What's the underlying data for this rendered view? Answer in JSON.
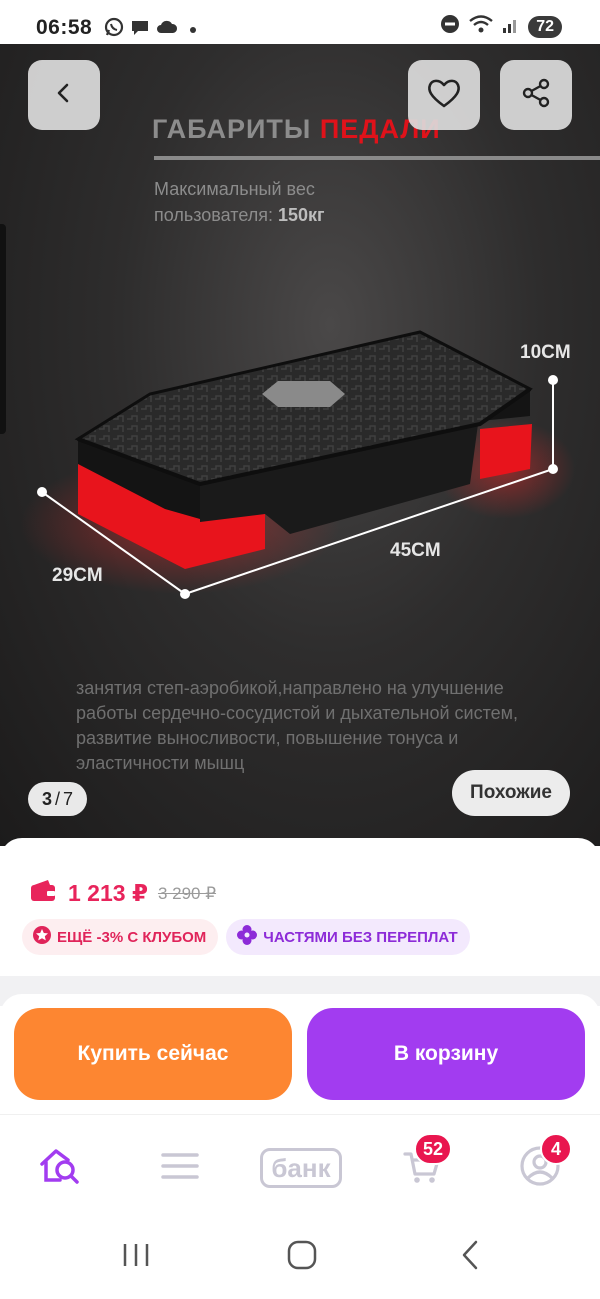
{
  "status_bar": {
    "time": "06:58",
    "battery": "72"
  },
  "hero": {
    "title_main": "ГАБАРИТЫ",
    "title_accent": "ПЕДАЛИ",
    "weight_text": "Максимальный вес пользователя:",
    "weight_value": "150кг",
    "dim_height": "10CM",
    "dim_length": "45CM",
    "dim_width": "29CM",
    "description": "занятия степ-аэробикой,направлено на улучшение работы сердечно-сосудистой и дыхательной систем, развитие выносливости, повышение тонуса и эластичности мышц",
    "counter_current": "3",
    "counter_total": "7",
    "similar_label": "Похожие",
    "icons": {
      "back": "chevron-left-icon",
      "favorite": "heart-icon",
      "share": "share-icon"
    }
  },
  "price": {
    "current": "1 213 ₽",
    "old": "3 290 ₽",
    "chips": [
      {
        "label": "ЕЩЁ -3% С КЛУБОМ",
        "icon": "star-badge-icon",
        "color": "#e0245a"
      },
      {
        "label": "ЧАСТЯМИ БЕЗ ПЕРЕПЛАТ",
        "icon": "flower-icon",
        "color": "#8d2bd8"
      }
    ]
  },
  "actions": {
    "buy_now": "Купить сейчас",
    "add_to_cart": "В корзину"
  },
  "bottom_nav": {
    "bank_label": "банк",
    "cart_badge": "52",
    "profile_badge": "4",
    "items": [
      "home-search-icon",
      "menu-icon",
      "bank-icon",
      "cart-icon",
      "profile-icon"
    ]
  },
  "colors": {
    "accent_pink": "#e8245b",
    "buy_orange": "#fd8631",
    "cart_purple": "#a23cf0",
    "nav_active": "#a23cf0"
  }
}
